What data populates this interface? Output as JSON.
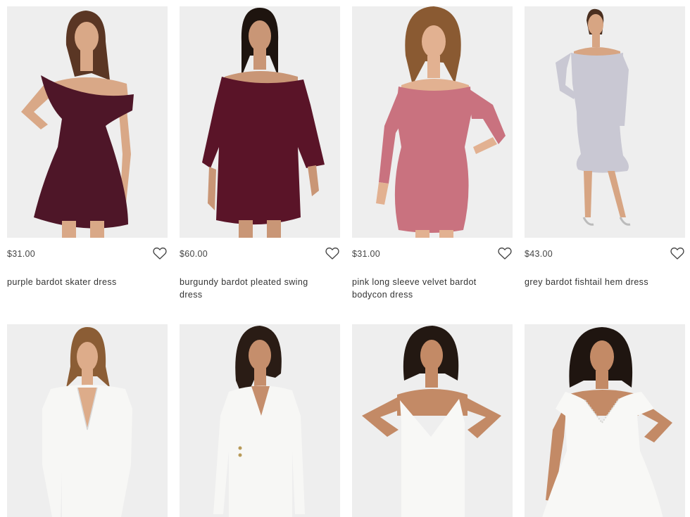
{
  "products": [
    {
      "price": "$31.00",
      "name": "purple bardot skater dress",
      "dress_color": "#4e1628",
      "skin": "#d9a887",
      "hair": "#5a3624"
    },
    {
      "price": "$60.00",
      "name": "burgundy bardot pleated swing dress",
      "dress_color": "#5a1428",
      "skin": "#c99676",
      "hair": "#1e140f"
    },
    {
      "price": "$31.00",
      "name": "pink long sleeve velvet bardot bodycon dress",
      "dress_color": "#c9727f",
      "skin": "#e2b191",
      "hair": "#8a5a32"
    },
    {
      "price": "$43.00",
      "name": "grey bardot fishtail hem dress",
      "dress_color": "#c9c8d3",
      "skin": "#d7a583",
      "hair": "#4a2f20"
    },
    {
      "dress_color": "#f7f7f5",
      "skin": "#ddac8a",
      "hair": "#8b5d35"
    },
    {
      "dress_color": "#f7f7f5",
      "skin": "#c58e6c",
      "hair": "#2a1c15"
    },
    {
      "dress_color": "#f8f8f6",
      "skin": "#c38a66",
      "hair": "#231812"
    },
    {
      "dress_color": "#f8f8f6",
      "skin": "#c38a66",
      "hair": "#1f1510"
    }
  ],
  "icons": {
    "wishlist": "heart-outline-icon"
  }
}
